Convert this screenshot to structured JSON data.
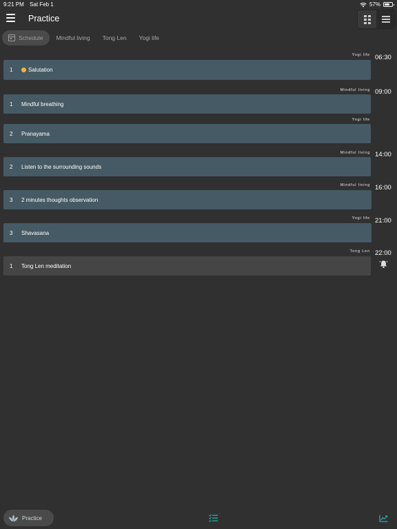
{
  "status_bar": {
    "time": "9:21 PM",
    "date": "Sat Feb 1",
    "battery_text": "57%",
    "battery_level": 0.57
  },
  "app_bar": {
    "title": "Practice",
    "menu_icon": "hamburger-menu-icon",
    "view_toggle": [
      {
        "icon": "grid-view-icon",
        "active": true
      },
      {
        "icon": "list-view-icon",
        "active": false
      }
    ]
  },
  "tabs": [
    {
      "label": "Schedule",
      "icon": "calendar-icon",
      "active": true
    },
    {
      "label": "Mindful living",
      "active": false
    },
    {
      "label": "Tong Len",
      "active": false
    },
    {
      "label": "Yogi life",
      "active": false
    }
  ],
  "schedule": [
    {
      "group": "Yogi life",
      "time": "06:30",
      "items": [
        {
          "num": "1",
          "title": "Salutation",
          "icon": "sun-icon"
        }
      ]
    },
    {
      "group": "Mindful living",
      "time": "09:00",
      "items": [
        {
          "num": "1",
          "title": "Mindful breathing"
        }
      ]
    },
    {
      "group": "Yogi life",
      "time": "",
      "items": [
        {
          "num": "2",
          "title": "Pranayama"
        }
      ]
    },
    {
      "group": "Mindful living",
      "time": "14:00",
      "items": [
        {
          "num": "2",
          "title": "Listen to the surrounding sounds"
        }
      ]
    },
    {
      "group": "Mindful living",
      "time": "16:00",
      "items": [
        {
          "num": "3",
          "title": "2 minutes thoughts observation"
        }
      ]
    },
    {
      "group": "Yogi life",
      "time": "21:00",
      "items": [
        {
          "num": "3",
          "title": "Shavasana"
        }
      ]
    },
    {
      "group": "Tong Len",
      "time": "22:00",
      "items": [
        {
          "num": "1",
          "title": "Tong Len meditation"
        }
      ],
      "alarm_icon": "bell-alarm-icon"
    }
  ],
  "bottom_nav": {
    "practice_label": "Practice",
    "practice_icon": "lotus-icon",
    "tasks_icon": "checklist-icon",
    "stats_icon": "trending-chart-icon",
    "accent": "#26a69a"
  },
  "colors": {
    "background": "#303030",
    "card": "#455a64",
    "card_inactive": "#454545",
    "sun": "#f9b233"
  }
}
